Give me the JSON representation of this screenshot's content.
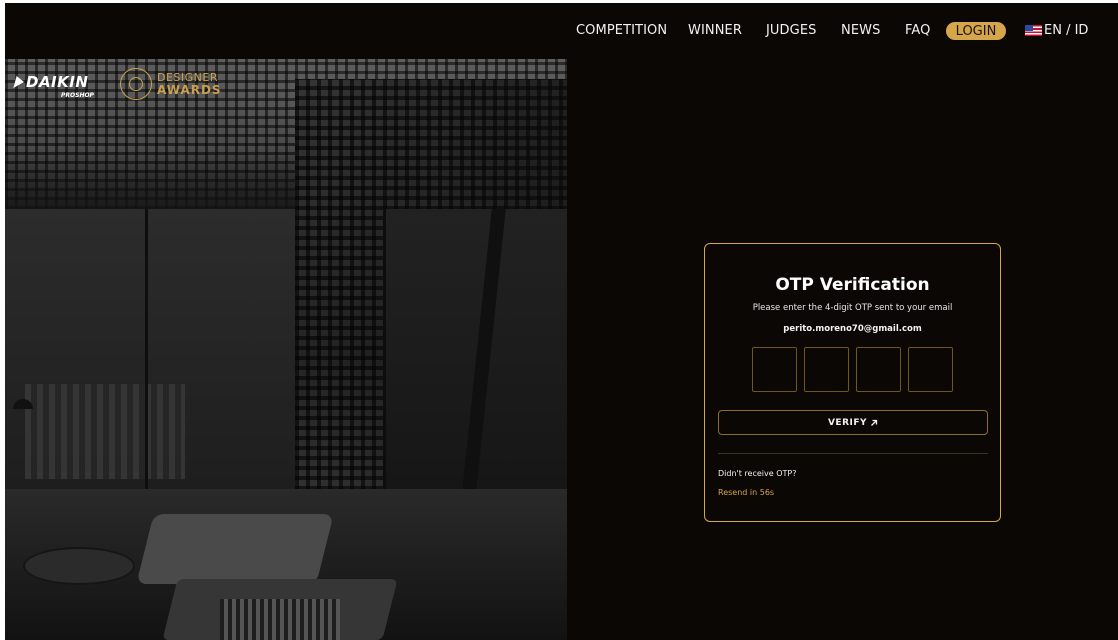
{
  "nav": {
    "items": [
      {
        "label": "COMPETITION"
      },
      {
        "label": "WINNER"
      },
      {
        "label": "JUDGES"
      },
      {
        "label": "NEWS"
      },
      {
        "label": "FAQ"
      }
    ],
    "login_label": "LOGIN",
    "language_label": "EN / ID",
    "flag_icon": "us-flag-icon"
  },
  "brand": {
    "daikin": "DAIKIN",
    "proshop": "PROSHOP",
    "award_line1": "DESIGNER",
    "award_line2": "AWARDS",
    "accent_color": "#d6a74a"
  },
  "otp": {
    "title": "OTP Verification",
    "subtitle": "Please enter the 4-digit OTP sent to your email",
    "email": "perito.moreno70@gmail.com",
    "digits": [
      "",
      "",
      "",
      ""
    ],
    "verify_label": "VERIFY",
    "verify_icon": "arrow-up-right-icon",
    "no_receive_text": "Didn't receive OTP?",
    "resend_text": "Resend in 56s"
  }
}
